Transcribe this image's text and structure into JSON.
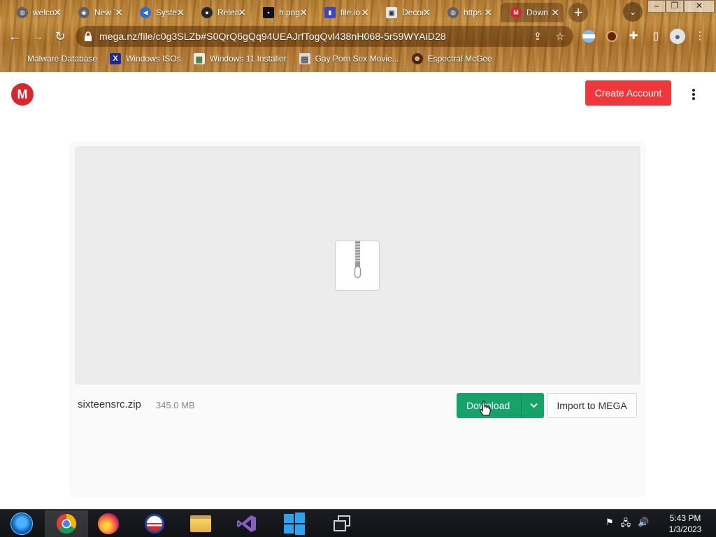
{
  "browser": {
    "tabs": [
      {
        "title": "welcome",
        "favicon": "globe-icon"
      },
      {
        "title": "New Tab",
        "favicon": "chrome-icon"
      },
      {
        "title": "System",
        "favicon": "system-icon"
      },
      {
        "title": "Releases",
        "favicon": "github-icon"
      },
      {
        "title": "h.png",
        "favicon": "image-icon"
      },
      {
        "title": "file.io",
        "favicon": "file-icon"
      },
      {
        "title": "Decompiler",
        "favicon": "decompiler-icon"
      },
      {
        "title": "https",
        "favicon": "globe-icon"
      },
      {
        "title": "Download",
        "favicon": "mega-icon",
        "active": true
      }
    ],
    "url": "mega.nz/file/c0g3SLZb#S0QrQ6gQq94UEAJrfTogQvl438nH068-5r59WYAiD28",
    "bookmarks": [
      {
        "label": "Malware Database",
        "icon": "malware-icon"
      },
      {
        "label": "Windows ISOs",
        "icon": "x-icon"
      },
      {
        "label": "Windows 11 Installer",
        "icon": "installer-icon"
      },
      {
        "label": "Gay Porn Sex Movie...",
        "icon": "page-icon"
      },
      {
        "label": "Espectral McGee",
        "icon": "avatar-icon"
      }
    ]
  },
  "page": {
    "logo": "M",
    "create_account": "Create Account",
    "file": {
      "name": "sixteensrc.zip",
      "size": "345.0 MB"
    },
    "download_label": "Download",
    "import_label": "Import to MEGA"
  },
  "taskbar": {
    "time": "5:43 PM",
    "date": "1/3/2023"
  },
  "colors": {
    "mega_red": "#d9272e",
    "create_button": "#f0373a",
    "download_green": "#16a36a"
  }
}
